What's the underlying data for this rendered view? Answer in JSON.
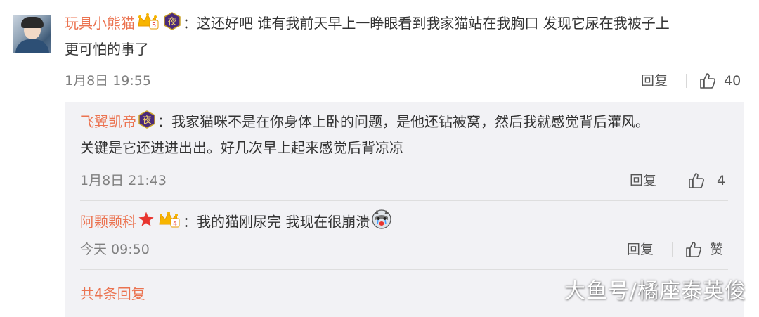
{
  "comment": {
    "username": "玩具小熊猫",
    "colon": "：",
    "text_line1": "这还好吧 谁有我前天早上一睁眼看到我家猫站在我胸口 发现它尿在我被子上",
    "text_line2": "更可怕的事了",
    "time": "1月8日 19:55",
    "reply_label": "回复",
    "like_count": "40",
    "badge_level": "5",
    "night_badge": "夜"
  },
  "replies": [
    {
      "username": "飞翼凯帝",
      "colon": "：",
      "text_line1": "我家猫咪不是在你身体上卧的问题，是他还钻被窝，然后我就感觉背后灌风。",
      "text_line2": "关键是它还进进出出。好几次早上起来感觉后背凉凉",
      "time": "1月8日 21:43",
      "reply_label": "回复",
      "like_count": "4",
      "night_badge": "夜"
    },
    {
      "username": "阿颗颗科",
      "colon": "：",
      "text_line1": "我的猫刚尿完 我现在很崩溃",
      "time": "今天 09:50",
      "reply_label": "回复",
      "like_label": "赞",
      "badge_level": "4"
    }
  ],
  "more_replies": "共4条回复",
  "watermark": "大鱼号/橘座泰英俊",
  "colors": {
    "username": "#eb7350",
    "meta_gray": "#808080",
    "reply_bg": "#f2f2f5",
    "star_red": "#e8352f",
    "night_badge_purple": "#4a2a7a"
  },
  "icons": [
    "vip-crown-icon",
    "night-badge-icon",
    "thumbs-up-icon",
    "red-star-icon",
    "crying-husky-emoji"
  ]
}
